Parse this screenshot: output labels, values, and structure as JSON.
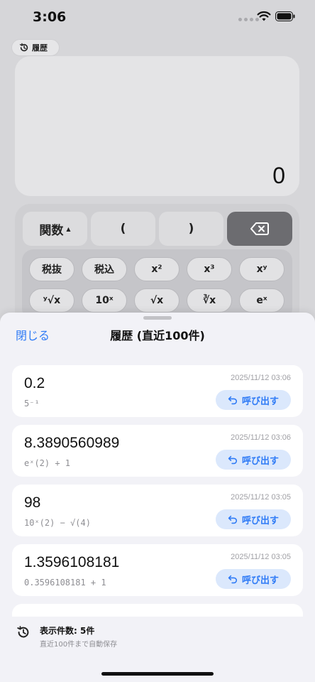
{
  "status": {
    "time": "3:06"
  },
  "history_button": {
    "label": "履歴"
  },
  "display": {
    "value": "0"
  },
  "top_keys": [
    {
      "label": "関数",
      "indicator": "▲"
    },
    {
      "label": "("
    },
    {
      "label": ")"
    },
    {
      "label": "backspace"
    }
  ],
  "function_keys": {
    "row1": [
      "税抜",
      "税込",
      "x²",
      "x³",
      "xʸ"
    ],
    "row2": [
      "ʸ√x",
      "10ˣ",
      "√x",
      "∛x",
      "eˣ"
    ]
  },
  "sheet": {
    "close_label": "閉じる",
    "title": "履歴 (直近100件)",
    "entries": [
      {
        "value": "0.2",
        "expression": "5⁻¹",
        "date": "2025/11/12 03:06",
        "recall_label": "呼び出す"
      },
      {
        "value": "8.3890560989",
        "expression": "eˣ(2) + 1",
        "date": "2025/11/12 03:06",
        "recall_label": "呼び出す"
      },
      {
        "value": "98",
        "expression": "10ˣ(2) − √(4)",
        "date": "2025/11/12 03:05",
        "recall_label": "呼び出す"
      },
      {
        "value": "1.3596108181",
        "expression": "0.3596108181 + 1",
        "date": "2025/11/12 03:05",
        "recall_label": "呼び出す"
      }
    ],
    "footer": {
      "count_label": "表示件数: 5件",
      "note": "直近100件まで自動保存"
    }
  },
  "colors": {
    "accent": "#2f7bf6",
    "recall_bg": "#dbe8fc",
    "dark_key": "#6c6c70"
  }
}
